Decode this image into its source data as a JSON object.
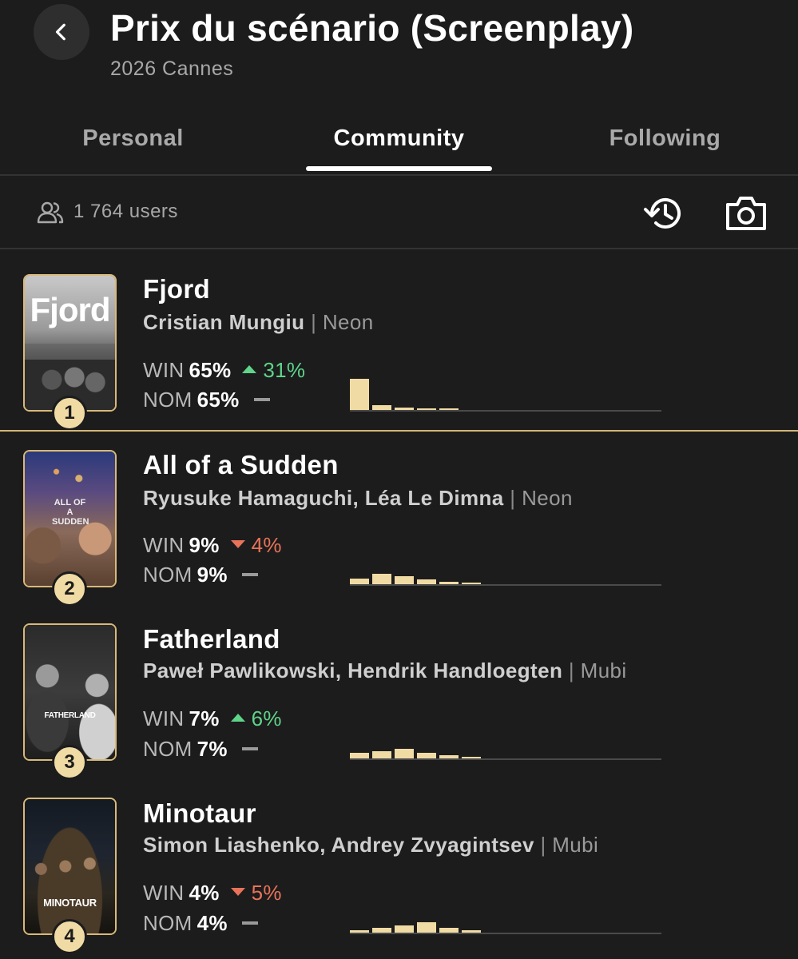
{
  "header": {
    "back_icon": "chevron-left-icon",
    "title": "Prix du scénario (Screenplay)",
    "subtitle": "2026 Cannes"
  },
  "tabs": [
    {
      "label": "Personal",
      "active": false
    },
    {
      "label": "Community",
      "active": true
    },
    {
      "label": "Following",
      "active": false
    }
  ],
  "toolbar": {
    "users_icon": "users-icon",
    "users_count": "1 764 users",
    "history_icon": "history-icon",
    "camera_icon": "camera-icon"
  },
  "colors": {
    "background": "#1c1c1c",
    "accent": "#f1dba5",
    "trend_up": "#5fd48a",
    "trend_down": "#e8735a"
  },
  "films": [
    {
      "rank": "1",
      "title": "Fjord",
      "directors": "Cristian Mungiu",
      "separator": "|",
      "distributor": "Neon",
      "poster_text": "Fjord",
      "win_label": "WIN",
      "win": "65%",
      "win_trend": "up",
      "win_change": "31%",
      "nom_label": "NOM",
      "nom": "65%",
      "nom_trend": "flat",
      "histogram": [
        0.85,
        0.14,
        0.06,
        0.03,
        0.02
      ]
    },
    {
      "rank": "2",
      "title": "All of a Sudden",
      "directors": "Ryusuke Hamaguchi, Léa Le Dimna",
      "separator": "|",
      "distributor": "Neon",
      "poster_text": "ALL OF A SUDDEN",
      "win_label": "WIN",
      "win": "9%",
      "win_trend": "down",
      "win_change": "4%",
      "nom_label": "NOM",
      "nom": "9%",
      "nom_trend": "flat",
      "histogram": [
        0.16,
        0.28,
        0.22,
        0.12,
        0.07,
        0.04
      ]
    },
    {
      "rank": "3",
      "title": "Fatherland",
      "directors": "Paweł Pawlikowski, Hendrik Handloegten",
      "separator": "|",
      "distributor": "Mubi",
      "poster_text": "FATHERLAND",
      "win_label": "WIN",
      "win": "7%",
      "win_trend": "up",
      "win_change": "6%",
      "nom_label": "NOM",
      "nom": "7%",
      "nom_trend": "flat",
      "histogram": [
        0.16,
        0.2,
        0.26,
        0.15,
        0.09,
        0.04
      ]
    },
    {
      "rank": "4",
      "title": "Minotaur",
      "directors": "Simon Liashenko, Andrey Zvyagintsev",
      "separator": "|",
      "distributor": "Mubi",
      "poster_text": "MINOTAUR",
      "win_label": "WIN",
      "win": "4%",
      "win_trend": "down",
      "win_change": "5%",
      "nom_label": "NOM",
      "nom": "4%",
      "nom_trend": "flat",
      "histogram": [
        0.06,
        0.13,
        0.2,
        0.28,
        0.14,
        0.06
      ]
    }
  ]
}
